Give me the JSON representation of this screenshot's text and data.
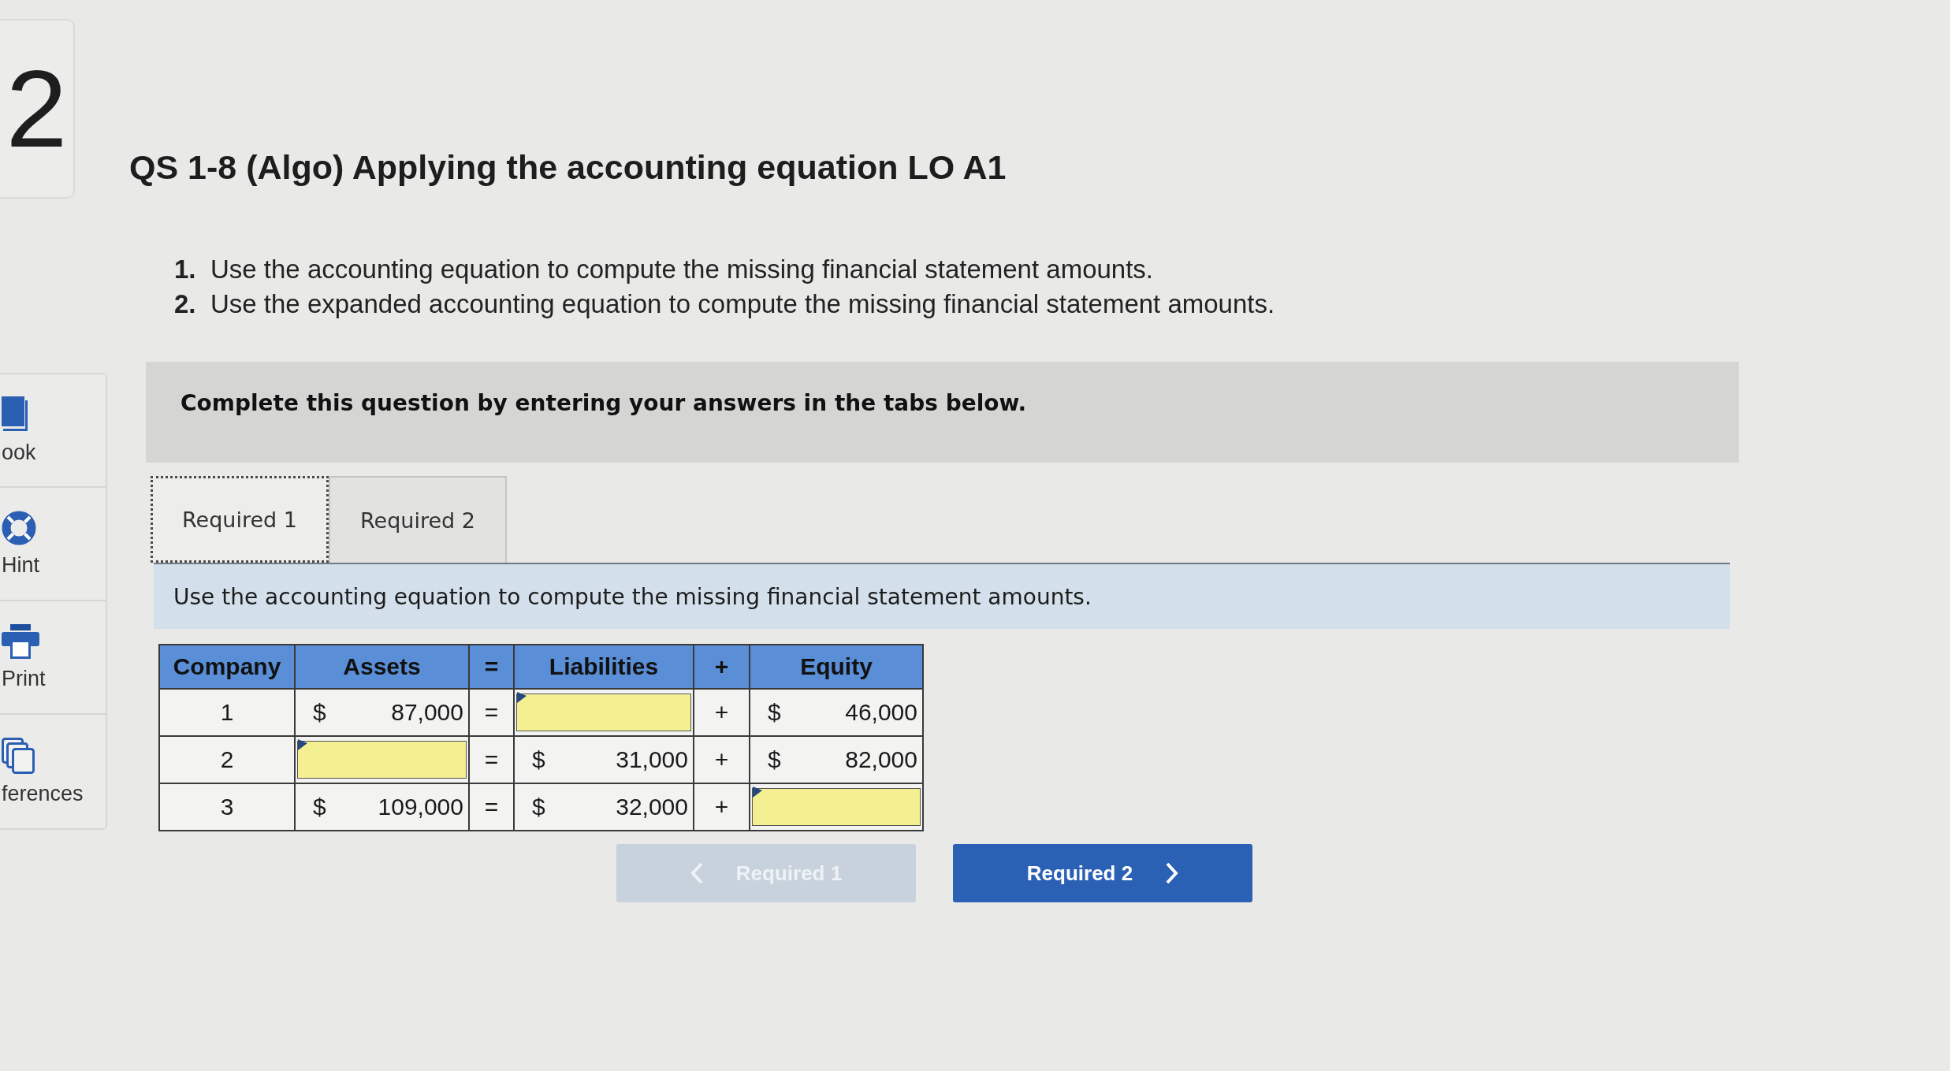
{
  "question_number": "2",
  "sidebar": {
    "items": [
      {
        "kind": "book",
        "label": "ook"
      },
      {
        "kind": "hint",
        "label": "Hint"
      },
      {
        "kind": "print",
        "label": "Print"
      },
      {
        "kind": "references",
        "label": "ferences"
      }
    ]
  },
  "title": "QS 1-8 (Algo) Applying the accounting equation LO A1",
  "steps": [
    {
      "number": "1.",
      "text": "Use the accounting equation to compute the missing financial statement amounts."
    },
    {
      "number": "2.",
      "text": "Use the expanded accounting equation to compute the missing financial statement amounts."
    }
  ],
  "banner": "Complete this question by entering your answers in the tabs below.",
  "tabs": [
    {
      "label": "Required 1",
      "selected": true
    },
    {
      "label": "Required 2",
      "selected": false
    }
  ],
  "tab_instruction": "Use the accounting equation to compute the missing financial statement amounts.",
  "table": {
    "columns": [
      "Company",
      "Assets",
      "=",
      "Liabilities",
      "+",
      "Equity"
    ],
    "rows": [
      {
        "cells": [
          {
            "kind": "label",
            "text": "1"
          },
          {
            "kind": "amount",
            "currency": "$",
            "value": "87,000"
          },
          {
            "kind": "operator",
            "text": "="
          },
          {
            "kind": "input"
          },
          {
            "kind": "operator",
            "text": "+"
          },
          {
            "kind": "amount",
            "currency": "$",
            "value": "46,000"
          }
        ]
      },
      {
        "cells": [
          {
            "kind": "label",
            "text": "2"
          },
          {
            "kind": "input"
          },
          {
            "kind": "operator",
            "text": "="
          },
          {
            "kind": "amount",
            "currency": "$",
            "value": "31,000"
          },
          {
            "kind": "operator",
            "text": "+"
          },
          {
            "kind": "amount",
            "currency": "$",
            "value": "82,000"
          }
        ]
      },
      {
        "cells": [
          {
            "kind": "label",
            "text": "3"
          },
          {
            "kind": "amount",
            "currency": "$",
            "value": "109,000"
          },
          {
            "kind": "operator",
            "text": "="
          },
          {
            "kind": "amount",
            "currency": "$",
            "value": "32,000"
          },
          {
            "kind": "operator",
            "text": "+"
          },
          {
            "kind": "input"
          }
        ]
      }
    ]
  },
  "nav_buttons": [
    {
      "kind": "previous",
      "label": "Required 1",
      "disabled": true
    },
    {
      "kind": "next",
      "label": "Required 2",
      "disabled": false
    }
  ]
}
